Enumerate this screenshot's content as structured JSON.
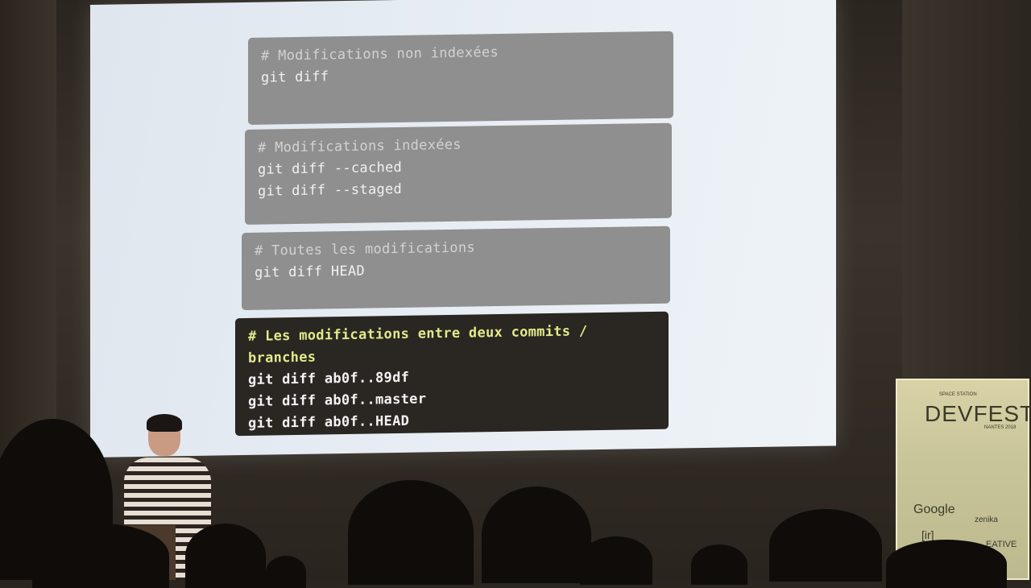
{
  "slide": {
    "blocks": [
      {
        "comment": "# Modifications non indexées",
        "commands": [
          "git diff"
        ]
      },
      {
        "comment": "# Modifications indexées",
        "commands": [
          "git diff --cached",
          "git diff --staged"
        ]
      },
      {
        "comment": "# Toutes les modifications",
        "commands": [
          "git diff HEAD"
        ]
      },
      {
        "comment": "# Les modifications entre deux commits / branches",
        "commands": [
          "git diff ab0f..89df",
          "git diff ab0f..master",
          "git diff ab0f..HEAD"
        ]
      }
    ]
  },
  "banner": {
    "subtitle": "SPACE STATION",
    "title": "DEVFEST",
    "date": "NANTES 2018",
    "sponsors": [
      "Google",
      "zenika",
      "[ir]",
      "EATIVE"
    ]
  },
  "colors": {
    "slide_bg": "#e8eef4",
    "code_block_gray": "#8f8f8f",
    "code_block_dark": "#2a2622",
    "highlight_comment": "#e4e98a"
  }
}
